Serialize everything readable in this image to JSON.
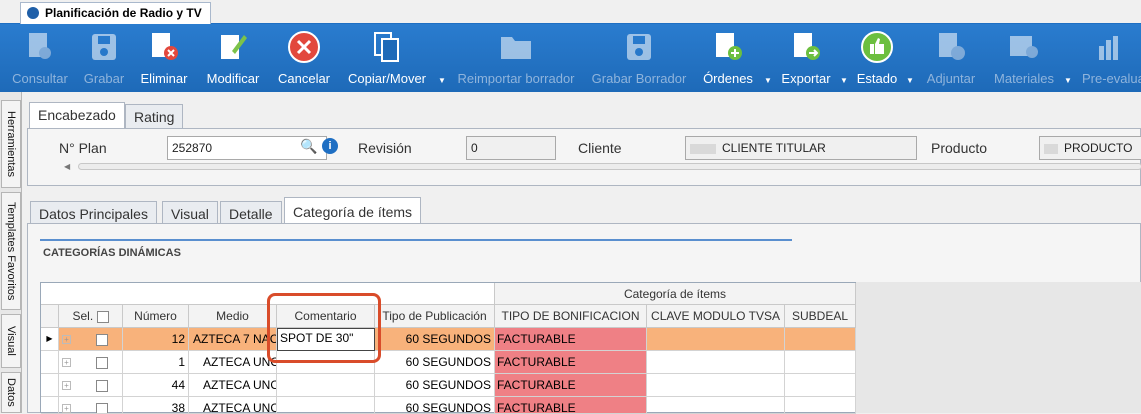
{
  "window": {
    "title": "Planificación de Radio y TV"
  },
  "toolbar": {
    "buttons": [
      {
        "label": "Consultar",
        "icon": "document-search-icon",
        "enabled": false
      },
      {
        "label": "Grabar",
        "icon": "save-icon",
        "enabled": false
      },
      {
        "label": "Eliminar",
        "icon": "delete-document-icon",
        "enabled": true
      },
      {
        "label": "Modificar",
        "icon": "edit-icon",
        "enabled": true
      },
      {
        "label": "Cancelar",
        "icon": "cancel-icon",
        "enabled": true
      },
      {
        "label": "Copiar/Mover",
        "icon": "copy-icon",
        "enabled": true
      },
      {
        "label": "Reimportar borrador",
        "icon": "folder-icon",
        "enabled": false
      },
      {
        "label": "Grabar Borrador",
        "icon": "save-draft-icon",
        "enabled": false
      },
      {
        "label": "Órdenes",
        "icon": "add-order-icon",
        "enabled": true
      },
      {
        "label": "Exportar",
        "icon": "export-icon",
        "enabled": true
      },
      {
        "label": "Estado",
        "icon": "thumbs-up-icon",
        "enabled": true
      },
      {
        "label": "Adjuntar",
        "icon": "attach-icon",
        "enabled": false
      },
      {
        "label": "Materiales",
        "icon": "materials-icon",
        "enabled": false
      },
      {
        "label": "Pre-evalua",
        "icon": "chart-icon",
        "enabled": false
      }
    ]
  },
  "side_tabs": [
    "Herramientas",
    "Templates Favoritos",
    "Visual",
    "Datos"
  ],
  "header_tabs": [
    "Encabezado",
    "Rating"
  ],
  "header": {
    "plan_label": "N° Plan",
    "plan_value": "252870",
    "revision_label": "Revisión",
    "revision_value": "0",
    "cliente_label": "Cliente",
    "cliente_value": "CLIENTE TITULAR",
    "producto_label": "Producto",
    "producto_value": "PRODUCTO"
  },
  "detail_tabs": [
    "Datos Principales",
    "Visual",
    "Detalle",
    "Categoría de ítems"
  ],
  "section_title": "CATEGORÍAS DINÁMICAS",
  "grid": {
    "group_header": "Categoría de ítems",
    "columns": [
      "Sel.",
      "Número",
      "Medio",
      "Comentario",
      "Tipo de Publicación",
      "TIPO DE BONIFICACION",
      "CLAVE MODULO TVSA",
      "SUBDEAL"
    ],
    "rows": [
      {
        "numero": "12",
        "medio": "AZTECA 7 NAC",
        "comentario": "SPOT DE 30\"",
        "tipo": "60 SEGUNDOS",
        "bonif": "FACTURABLE"
      },
      {
        "numero": "1",
        "medio": "AZTECA UNO",
        "comentario": "",
        "tipo": "60 SEGUNDOS",
        "bonif": "FACTURABLE"
      },
      {
        "numero": "44",
        "medio": "AZTECA UNO",
        "comentario": "",
        "tipo": "60 SEGUNDOS",
        "bonif": "FACTURABLE"
      },
      {
        "numero": "38",
        "medio": "AZTECA UNO",
        "comentario": "",
        "tipo": "60 SEGUNDOS",
        "bonif": "FACTURABLE"
      }
    ]
  }
}
